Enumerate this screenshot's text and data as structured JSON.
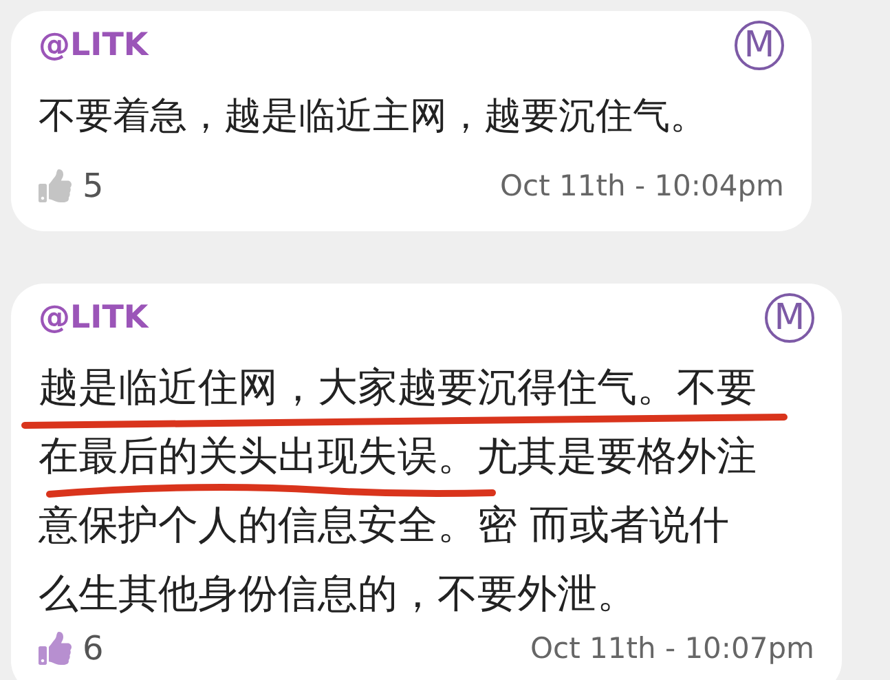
{
  "posts": [
    {
      "author": "@LITK",
      "badge": "M",
      "body_lines": [
        "不要着急，越是临近主网，越要沉住气。"
      ],
      "likes": "5",
      "liked": false,
      "time": "Oct 11th - 10:04pm"
    },
    {
      "author": "@LITK",
      "badge": "M",
      "body_lines": [
        "越是临近住网，大家越要沉得住气。不要",
        "在最后的关头出现失误。尤其是要格外注",
        "意保护个人的信息安全。密 而或者说什",
        "么生其他身份信息的，不要外泄。"
      ],
      "likes": "6",
      "liked": true,
      "time": "Oct 11th - 10:07pm"
    }
  ]
}
